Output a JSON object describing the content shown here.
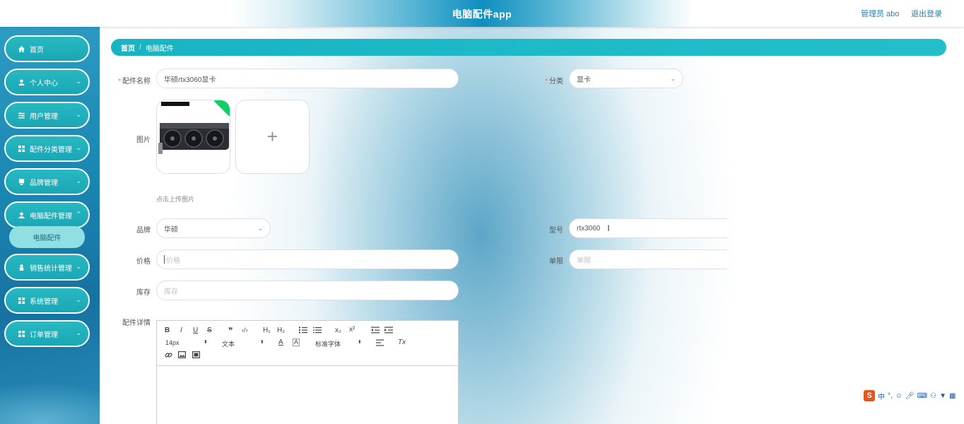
{
  "app": {
    "title": "电脑配件app"
  },
  "header": {
    "user": "管理员 abo",
    "logout": "退出登录"
  },
  "sidebar": {
    "items": [
      {
        "label": "首页",
        "icon": "home-icon",
        "has_arrow": false
      },
      {
        "label": "个人中心",
        "icon": "user-icon",
        "has_arrow": true
      },
      {
        "label": "用户管理",
        "icon": "sliders-icon",
        "has_arrow": true
      },
      {
        "label": "配件分类管理",
        "icon": "grid-icon",
        "has_arrow": true
      },
      {
        "label": "品牌管理",
        "icon": "monitor-icon",
        "has_arrow": true
      },
      {
        "label": "电脑配件管理",
        "icon": "user-icon",
        "has_arrow": true
      },
      {
        "label": "销售统计管理",
        "icon": "person-icon",
        "has_arrow": true
      },
      {
        "label": "系统管理",
        "icon": "grid-icon",
        "has_arrow": true
      },
      {
        "label": "订单管理",
        "icon": "grid-icon",
        "has_arrow": true
      }
    ],
    "sub_item": "电脑配件"
  },
  "breadcrumb": {
    "home": "首页",
    "sep": "/",
    "current": "电脑配件"
  },
  "form": {
    "name_label": "配件名称",
    "name_value": "华硕rtx3060显卡",
    "category_label": "分类",
    "category_value": "显卡",
    "image_label": "图片",
    "upload_hint": "点击上传图片",
    "upload_plus": "+",
    "brand_label": "品牌",
    "brand_value": "华硕",
    "model_label": "型号",
    "model_value": "rtx3060",
    "price_label": "价格",
    "price_placeholder": "价格",
    "limit_label": "单限",
    "limit_placeholder": "单限",
    "stock_label": "库存",
    "stock_placeholder": "库存",
    "detail_label": "配件详情"
  },
  "editor": {
    "font_size": "14px",
    "text_type": "文本",
    "font_family": "标准字体",
    "buttons": {
      "bold": "B",
      "italic": "I",
      "underline": "U",
      "strike": "S",
      "quote": "❞",
      "code": "‹/›",
      "h1": "H₁",
      "h2": "H₂",
      "sub": "x₂",
      "sup": "x²",
      "clean": "Tx"
    }
  },
  "ime": {
    "lang": "中"
  }
}
